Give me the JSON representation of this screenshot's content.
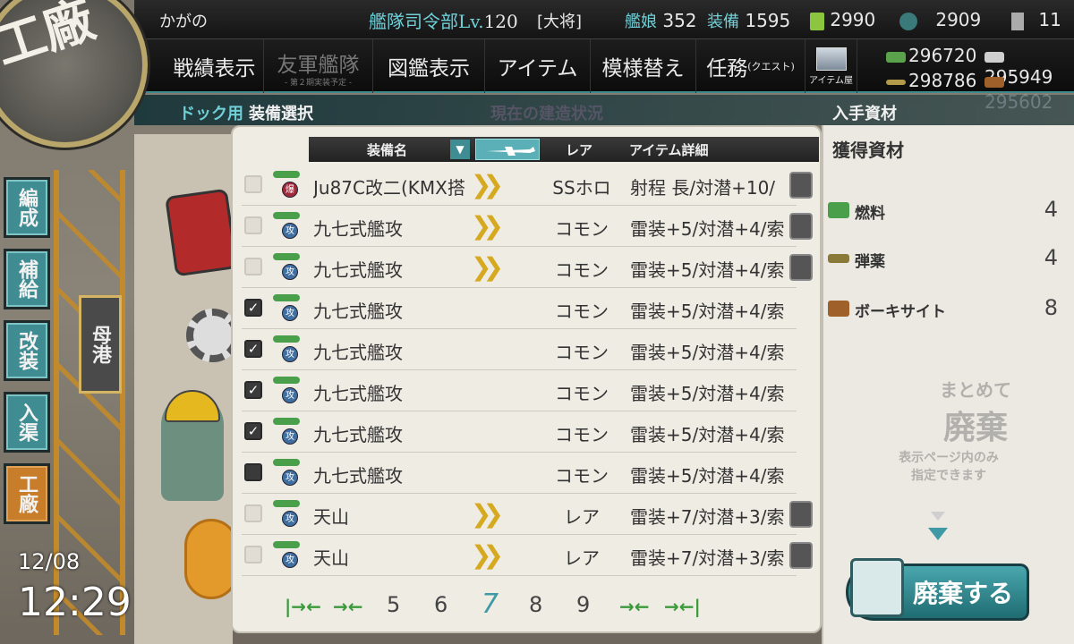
{
  "header": {
    "player_name": "かがの",
    "hq_label": "艦隊司令部Lv.",
    "hq_level": "120",
    "rank": "[大将]",
    "ships_label": "艦娘",
    "ships_count": "352",
    "equip_label": "装備",
    "equip_count": "1595",
    "bucket_count": "2990",
    "devmat_count": "2909",
    "screw_count": "11"
  },
  "nav": {
    "record": "戦績表示",
    "friend": "友軍艦隊",
    "friend_sub": "- 第２期実装予定 -",
    "library": "図鑑表示",
    "items": "アイテム",
    "furniture": "模様替え",
    "quests": "任務",
    "quests_sub": "(クエスト)",
    "shop": "アイテム屋"
  },
  "resources": {
    "fuel": "296720",
    "ammo": "295949",
    "steel": "298786",
    "bauxite": "295602"
  },
  "breadcrumb": {
    "dock": "ドック用",
    "select": "装備選択",
    "status": "現在の建造状況",
    "gain": "入手資材"
  },
  "logo": {
    "text": "工廠"
  },
  "sidemenu": {
    "organize": "編成",
    "supply": "補給",
    "remodel": "改装",
    "dock": "入渠",
    "arsenal": "工廠",
    "port": "母港"
  },
  "clock": {
    "date": "12/08",
    "time": "12:29"
  },
  "table": {
    "col_name": "装備名",
    "col_rarity": "レア",
    "col_detail": "アイテム詳細",
    "rows": [
      {
        "name": "Ju87C改二(KMX搭",
        "rarity": "SSホロ",
        "detail": "射程 長/対潜+10/",
        "checked": false,
        "badge": "爆",
        "improved": true,
        "locked": true
      },
      {
        "name": "九七式艦攻",
        "rarity": "コモン",
        "detail": "雷装+5/対潜+4/索",
        "checked": false,
        "badge": "攻",
        "improved": true,
        "locked": true
      },
      {
        "name": "九七式艦攻",
        "rarity": "コモン",
        "detail": "雷装+5/対潜+4/索",
        "checked": false,
        "badge": "攻",
        "improved": true,
        "locked": true
      },
      {
        "name": "九七式艦攻",
        "rarity": "コモン",
        "detail": "雷装+5/対潜+4/索",
        "checked": true,
        "badge": "攻",
        "improved": false,
        "locked": false
      },
      {
        "name": "九七式艦攻",
        "rarity": "コモン",
        "detail": "雷装+5/対潜+4/索",
        "checked": true,
        "badge": "攻",
        "improved": false,
        "locked": false
      },
      {
        "name": "九七式艦攻",
        "rarity": "コモン",
        "detail": "雷装+5/対潜+4/索",
        "checked": true,
        "badge": "攻",
        "improved": false,
        "locked": false
      },
      {
        "name": "九七式艦攻",
        "rarity": "コモン",
        "detail": "雷装+5/対潜+4/索",
        "checked": true,
        "badge": "攻",
        "improved": false,
        "locked": false
      },
      {
        "name": "九七式艦攻",
        "rarity": "コモン",
        "detail": "雷装+5/対潜+4/索",
        "checked": false,
        "badge": "攻",
        "improved": false,
        "locked": false
      },
      {
        "name": "天山",
        "rarity": "レア",
        "detail": "雷装+7/対潜+3/索",
        "checked": false,
        "badge": "攻",
        "improved": true,
        "locked": true
      },
      {
        "name": "天山",
        "rarity": "レア",
        "detail": "雷装+7/対潜+3/索",
        "checked": false,
        "badge": "攻",
        "improved": true,
        "locked": true
      }
    ]
  },
  "pager": {
    "pages": [
      "5",
      "6",
      "7",
      "8",
      "9"
    ],
    "current": "7"
  },
  "gain_panel": {
    "title": "獲得資材",
    "fuel_label": "燃料",
    "fuel_value": "4",
    "ammo_label": "弾薬",
    "ammo_value": "4",
    "bauxite_label": "ボーキサイト",
    "bauxite_value": "8"
  },
  "bulk": {
    "line1": "まとめて",
    "line2": "廃棄",
    "line3": "表示ページ内のみ",
    "line4": "指定できます"
  },
  "discard_button": "廃棄する",
  "colors": {
    "accent": "#3f9aa5",
    "orange": "#c87d2a",
    "gold": "#d5a920"
  }
}
